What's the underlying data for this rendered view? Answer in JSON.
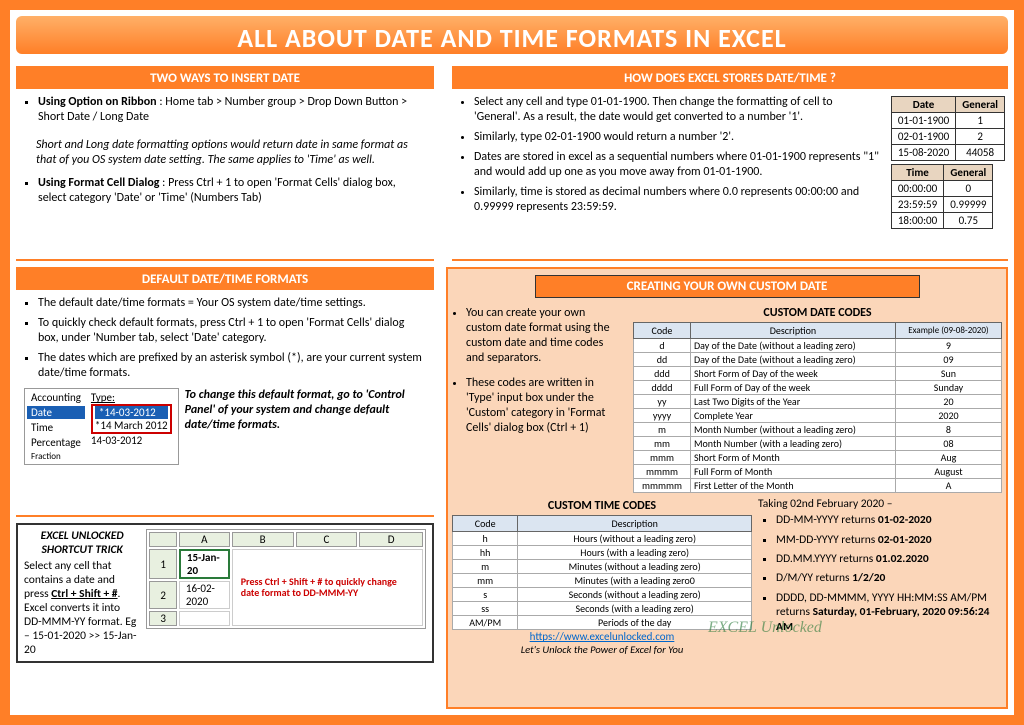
{
  "title": "ALL ABOUT DATE AND TIME FORMATS IN EXCEL",
  "left1": {
    "header": "TWO WAYS TO INSERT DATE",
    "b1_label": "Using Option on Ribbon",
    "b1_text": " : Home tab > Number group > Drop Down Button > Short Date / Long Date",
    "note": "Short and Long date formatting options would return date in same format as that of you OS system date setting. The same applies to 'Time' as well.",
    "b2_label": "Using Format Cell Dialog",
    "b2_text": " : Press Ctrl + 1 to open 'Format Cells' dialog box, select category 'Date' or 'Time' (Numbers Tab)"
  },
  "right1": {
    "header": "HOW DOES EXCEL STORES DATE/TIME ?",
    "bullets": [
      "Select any cell and type 01-01-1900. Then change the formatting of cell to 'General'. As a result, the date would get converted to a number '1'.",
      "Similarly, type 02-01-1900 would return a number '2'.",
      "Dates are stored in excel as a sequential numbers where 01-01-1900 represents \"1\" and would add up one as you move away from 01-01-1900.",
      "Similarly, time is stored as decimal numbers where 0.0 represents 00:00:00 and 0.99999 represents 23:59:59."
    ],
    "dateTable": {
      "h1": "Date",
      "h2": "General",
      "rows": [
        [
          "01-01-1900",
          "1"
        ],
        [
          "02-01-1900",
          "2"
        ],
        [
          "15-08-2020",
          "44058"
        ]
      ]
    },
    "timeTable": {
      "h1": "Time",
      "h2": "General",
      "rows": [
        [
          "00:00:00",
          "0"
        ],
        [
          "23:59:59",
          "0.99999"
        ],
        [
          "18:00:00",
          "0.75"
        ]
      ]
    }
  },
  "left2": {
    "header": "DEFAULT DATE/TIME FORMATS",
    "bullets": [
      "The default date/time formats = Your OS system date/time settings.",
      "To quickly check default formats, press Ctrl + 1 to open 'Format Cells' dialog box, under 'Number tab, select 'Date' category.",
      "The dates which are prefixed by an asterisk symbol (*), are your current system date/time formats."
    ],
    "dialog": {
      "cat": [
        "Accounting",
        "Date",
        "Time",
        "Percentage",
        "Fraction"
      ],
      "typeLabel": "Type:",
      "types": [
        "*14-03-2012",
        "*14 March 2012",
        "14-03-2012"
      ]
    },
    "sideNote": "To change this default format, go to 'Control Panel' of your system and change default date/time formats."
  },
  "shortcut": {
    "title": "EXCEL UNLOCKED SHORTCUT TRICK",
    "text1": "Select any cell that contains a date and press ",
    "key": "Ctrl + Shift + #",
    "text2": ". Excel converts it into DD-MMM-YY format. Eg – 15-01-2020 >> 15-Jan-20",
    "mock": {
      "cols": [
        "",
        "A",
        "B",
        "C",
        "D"
      ],
      "rows": [
        [
          "1",
          "15-Jan-20",
          "",
          "",
          ""
        ],
        [
          "2",
          "16-02-2020",
          "",
          "",
          ""
        ],
        [
          "3",
          "",
          "",
          "",
          ""
        ]
      ]
    },
    "callout": "Press Ctrl + Shift + # to quickly change date format to DD-MMM-YY"
  },
  "custom": {
    "header": "CREATING YOUR OWN CUSTOM DATE",
    "intro": [
      "You can create your own custom date format using the custom date and time codes and separators.",
      "These codes are written in 'Type' input box under the 'Custom' category in 'Format Cells' dialog box (Ctrl + 1)"
    ],
    "dateCodes": {
      "title": "CUSTOM DATE CODES",
      "cols": [
        "Code",
        "Description",
        "Example (09-08-2020)"
      ],
      "rows": [
        [
          "d",
          "Day of the Date (without a leading zero)",
          "9"
        ],
        [
          "dd",
          "Day of the Date (without a leading zero)",
          "09"
        ],
        [
          "ddd",
          "Short Form of Day of the week",
          "Sun"
        ],
        [
          "dddd",
          "Full Form of Day of the week",
          "Sunday"
        ],
        [
          "yy",
          "Last Two Digits of the Year",
          "20"
        ],
        [
          "yyyy",
          "Complete Year",
          "2020"
        ],
        [
          "m",
          "Month Number (without a leading zero)",
          "8"
        ],
        [
          "mm",
          "Month Number (with a leading zero)",
          "08"
        ],
        [
          "mmm",
          "Short Form of Month",
          "Aug"
        ],
        [
          "mmmm",
          "Full Form of Month",
          "August"
        ],
        [
          "mmmmm",
          "First Letter of the Month",
          "A"
        ]
      ]
    },
    "timeCodes": {
      "title": "CUSTOM TIME CODES",
      "cols": [
        "Code",
        "Description"
      ],
      "rows": [
        [
          "h",
          "Hours (without a leading zero)"
        ],
        [
          "hh",
          "Hours (with a leading zero)"
        ],
        [
          "m",
          "Minutes (without a leading zero)"
        ],
        [
          "mm",
          "Minutes (with a leading zero0"
        ],
        [
          "s",
          "Seconds (without a leading zero)"
        ],
        [
          "ss",
          "Seconds (with a leading zero)"
        ],
        [
          "AM/PM",
          "Periods of the day"
        ]
      ]
    },
    "examplesHeader": "Taking 02nd February 2020 –",
    "examples": [
      {
        "pre": "DD-MM-YYYY returns ",
        "val": "01-02-2020"
      },
      {
        "pre": "MM-DD-YYYY returns ",
        "val": "02-01-2020"
      },
      {
        "pre": "DD.MM.YYYY returns ",
        "val": "01.02.2020"
      },
      {
        "pre": "D/M/YY returns ",
        "val": "1/2/20"
      },
      {
        "pre": "DDDD, DD-MMMM, YYYY HH:MM:SS AM/PM returns ",
        "val": "Saturday, 01-February, 2020 09:56:24 AM"
      }
    ],
    "link": "https://www.excelunlocked.com",
    "tagline": "Let's Unlock the Power of Excel for You",
    "watermark": "EXCEL Unlocked"
  }
}
